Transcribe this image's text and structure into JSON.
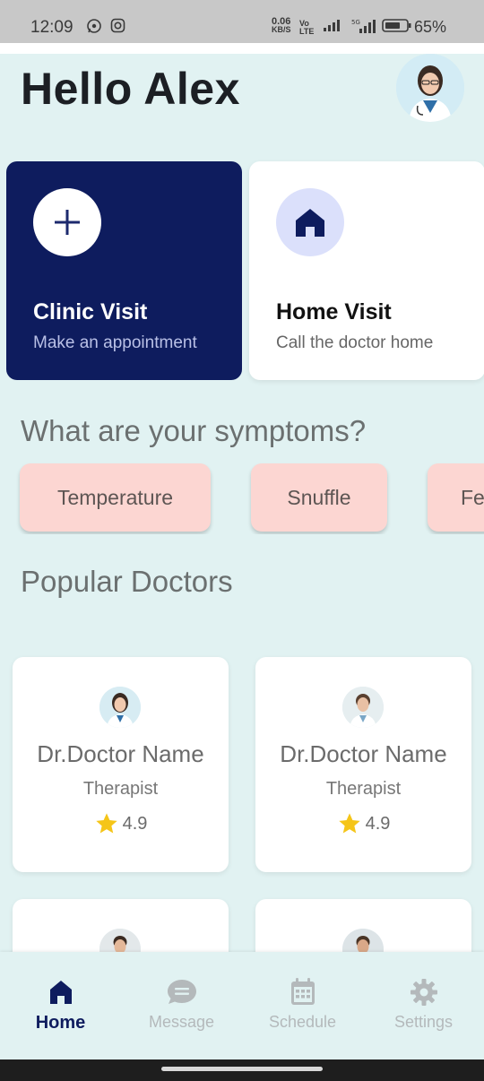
{
  "status_bar": {
    "time": "12:09",
    "net_speed": "0.06",
    "net_unit": "KB/S",
    "volte": "Vo LTE",
    "battery": "65%"
  },
  "greeting": "Hello Alex",
  "visit_cards": [
    {
      "title": "Clinic Visit",
      "subtitle": "Make an appointment",
      "icon": "plus-icon"
    },
    {
      "title": "Home Visit",
      "subtitle": "Call the doctor home",
      "icon": "home-icon"
    }
  ],
  "symptoms": {
    "title": "What are your symptoms?",
    "chips": [
      "Temperature",
      "Snuffle",
      "Fe"
    ]
  },
  "popular": {
    "title": "Popular Doctors",
    "doctors": [
      {
        "name": "Dr.Doctor Name",
        "specialty": "Therapist",
        "rating": "4.9"
      },
      {
        "name": "Dr.Doctor Name",
        "specialty": "Therapist",
        "rating": "4.9"
      },
      {
        "name": "",
        "specialty": "",
        "rating": ""
      },
      {
        "name": "",
        "specialty": "",
        "rating": ""
      }
    ]
  },
  "nav": [
    {
      "label": "Home",
      "icon": "home-icon",
      "active": true
    },
    {
      "label": "Message",
      "icon": "message-icon",
      "active": false
    },
    {
      "label": "Schedule",
      "icon": "calendar-icon",
      "active": false
    },
    {
      "label": "Settings",
      "icon": "gear-icon",
      "active": false
    }
  ],
  "colors": {
    "background": "#e1f2f2",
    "primary": "#0e1c5e",
    "chip": "#fcd6d2",
    "star": "#f5c518"
  }
}
